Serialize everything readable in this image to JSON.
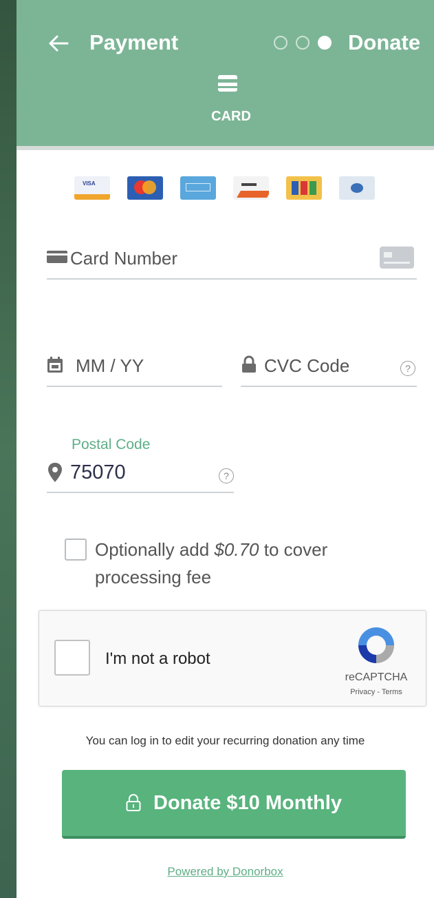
{
  "colors": {
    "header_bg": "#7cb596",
    "accent_green": "#58b37d",
    "link_green": "#5fae86"
  },
  "header": {
    "title": "Payment",
    "step_label": "Donate",
    "steps": [
      "inactive",
      "inactive",
      "active"
    ],
    "tab_label": "CARD",
    "back_icon": "back-arrow-icon",
    "tab_icon": "credit-card-icon"
  },
  "card_brands": [
    "VISA",
    "Mastercard",
    "American Express",
    "Discover",
    "JCB",
    "Diners Club"
  ],
  "form": {
    "card_number_label": "Card Number",
    "expiry_label": "MM / YY",
    "cvc_label": "CVC Code",
    "postal_label": "Postal Code",
    "postal_value": "75070",
    "help_glyph": "?"
  },
  "fee": {
    "prefix": "Optionally add ",
    "amount": "$0.70",
    "suffix": " to cover processing fee",
    "checked": false
  },
  "captcha": {
    "label": "I'm not a robot",
    "brand": "reCAPTCHA",
    "links": "Privacy - Terms"
  },
  "recurring_note": "You can log in to edit your recurring donation any time",
  "donate_button": "Donate $10 Monthly",
  "powered_by": "Powered by Donorbox"
}
